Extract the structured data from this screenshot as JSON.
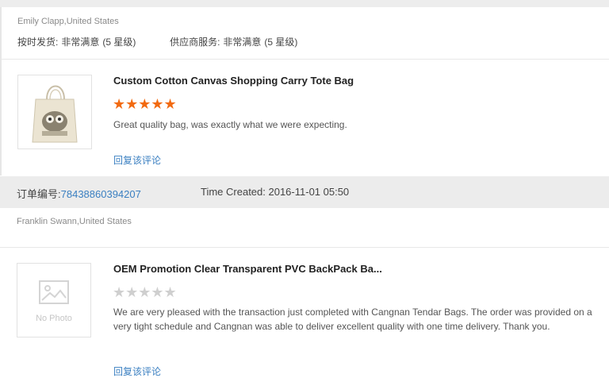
{
  "reviews": [
    {
      "buyer": "Emily Clapp,United States",
      "ratings": {
        "delivery_label": "按时发货:",
        "delivery_value": "非常满意",
        "delivery_stars": "(5 星级)",
        "service_label": "供应商服务:",
        "service_value": "非常满意",
        "service_stars": "(5 星级)"
      },
      "product_title": "Custom Cotton Canvas Shopping Carry Tote Bag",
      "rating": 5,
      "stars_text": "★★★★★",
      "comment": "Great quality bag, was exactly what we were expecting.",
      "reply_label": "回复该评论"
    },
    {
      "buyer": "Franklin Swann,United States",
      "product_title": "OEM Promotion Clear Transparent PVC BackPack Ba...",
      "rating": 0,
      "stars_text": "★★★★★",
      "thumb_text": "No Photo",
      "comment": "We are very pleased with the transaction just completed with Cangnan Tendar Bags.     The order was provided on a very tight schedule and Cangnan was able to deliver excellent quality with one time delivery.  Thank you.",
      "reply_label": "回复该评论"
    }
  ],
  "order": {
    "label": "订单编号:",
    "number": "78438860394207",
    "time_created": "Time Created: 2016-11-01 05:50"
  },
  "colors": {
    "accent_link": "#3a7fc1",
    "star_active": "#f26a10",
    "star_inactive": "#cfcfcf"
  }
}
